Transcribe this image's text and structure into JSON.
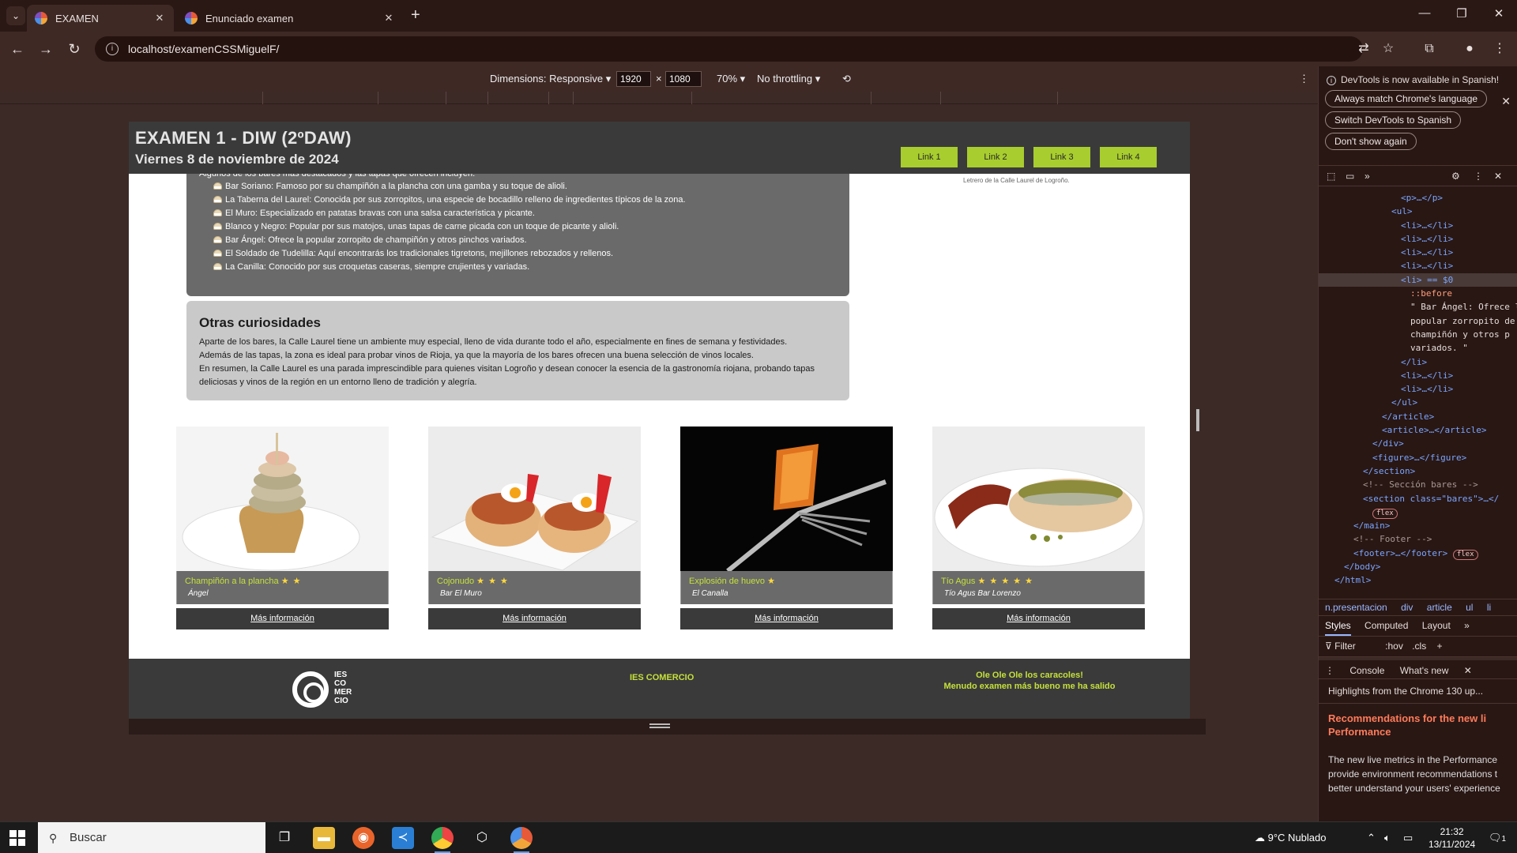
{
  "browser": {
    "tabs": [
      {
        "title": "EXAMEN",
        "active": true
      },
      {
        "title": "Enunciado examen",
        "active": false
      }
    ],
    "url": "localhost/examenCSSMiguelF/"
  },
  "device_toolbar": {
    "dimensions_label": "Dimensions: Responsive",
    "width": "1920",
    "height": "1080",
    "zoom": "70%",
    "throttling": "No throttling"
  },
  "page": {
    "header": {
      "title": "EXAMEN 1 - DIW (2ºDAW)",
      "date": "Viernes 8 de noviembre de 2024",
      "links": [
        "Link 1",
        "Link 2",
        "Link 3",
        "Link 4"
      ]
    },
    "bars_article": {
      "intro": "Algunos de los bares más destacados y las tapas que ofrecen incluyen:",
      "items": [
        "Bar Soriano: Famoso por su champiñón a la plancha con una gamba y su toque de alioli.",
        "La Taberna del Laurel: Conocida por sus zorropitos, una especie de bocadillo relleno de ingredientes típicos de la zona.",
        "El Muro: Especializado en patatas bravas con una salsa característica y picante.",
        "Blanco y Negro: Popular por sus matojos, unas tapas de carne picada con un toque de picante y alioli.",
        "Bar Ángel: Ofrece la popular zorropito de champiñón y otros pinchos variados.",
        "El Soldado de Tudelilla: Aquí encontrarás los tradicionales tigretons, mejillones rebozados y rellenos.",
        "La Canilla: Conocido por sus croquetas caseras, siempre crujientes y variadas."
      ]
    },
    "side_caption": "Letrero de la Calle Laurel de Logroño.",
    "curiosities": {
      "title": "Otras curiosidades",
      "paragraphs": [
        "Aparte de los bares, la Calle Laurel tiene un ambiente muy especial, lleno de vida durante todo el año, especialmente en fines de semana y festividades.",
        "Además de las tapas, la zona es ideal para probar vinos de Rioja, ya que la mayoría de los bares ofrecen una buena selección de vinos locales.",
        "En resumen, la Calle Laurel es una parada imprescindible para quienes visitan Logroño y desean conocer la esencia de la gastronomía riojana, probando tapas deliciosas y vinos de la región en un entorno lleno de tradición y alegría."
      ]
    },
    "cards": [
      {
        "name": "Champiñón a la plancha",
        "stars": "★ ★",
        "rating": 2,
        "bar": "Ángel",
        "more": "Más información"
      },
      {
        "name": "Cojonudo",
        "stars": "★ ★ ★",
        "rating": 3,
        "bar": "Bar El Muro",
        "more": "Más información"
      },
      {
        "name": "Explosión de huevo",
        "stars": "★",
        "rating": 1,
        "bar": "El Canalla",
        "more": "Más información"
      },
      {
        "name": "Tío Agus",
        "stars": "★ ★ ★ ★ ★",
        "rating": 5,
        "bar": "Tío Agus Bar Lorenzo",
        "more": "Más información"
      }
    ],
    "footer": {
      "logo_text": [
        "IES",
        "CO",
        "MER",
        "CIO"
      ],
      "center": "IES COMERCIO",
      "right_line1": "Ole Ole Ole los caracoles!",
      "right_line2": "Menudo examen más bueno me ha salido"
    }
  },
  "devtools": {
    "notice": "DevTools is now available in Spanish!",
    "buttons": [
      "Always match Chrome's language",
      "Switch DevTools to Spanish",
      "Don't show again"
    ],
    "dom_lines": [
      "<p>…</p>",
      "<ul>",
      "<li>…</li>",
      "<li>…</li>",
      "<li>…</li>",
      "<li>…</li>",
      "<li> == $0",
      "::before",
      "\" Bar Ángel: Ofrece la",
      "popular zorropito de",
      "champiñón y otros p",
      "variados. \"",
      "</li>",
      "<li>…</li>",
      "<li>…</li>",
      "</ul>",
      "</article>",
      "<article>…</article>",
      "</div>",
      "<figure>…</figure>",
      "</section>",
      "<!-- Sección bares -->",
      "<section class=\"bares\">…</",
      "flex",
      "</main>",
      "<!-- Footer -->",
      "<footer>…</footer>",
      "flex",
      "</body>",
      "</html>"
    ],
    "breadcrumbs": [
      "n.presentacion",
      "div",
      "article",
      "ul",
      "li"
    ],
    "styles_tabs": [
      "Styles",
      "Computed",
      "Layout"
    ],
    "filter_placeholder": "Filter",
    "filter_tools": [
      ":hov",
      ".cls"
    ],
    "drawer_tabs": [
      "Console",
      "What's new"
    ],
    "highlights": "Highlights from the Chrome 130 up...",
    "whats_new_title": "Recommendations for the new li Performance",
    "whats_new_body": "The new live metrics in the Performance provide environment recommendations t better understand your users' experience"
  },
  "taskbar": {
    "search_placeholder": "Buscar",
    "weather": "9°C  Nublado",
    "time": "21:32",
    "date": "13/11/2024",
    "notifications": "1"
  }
}
